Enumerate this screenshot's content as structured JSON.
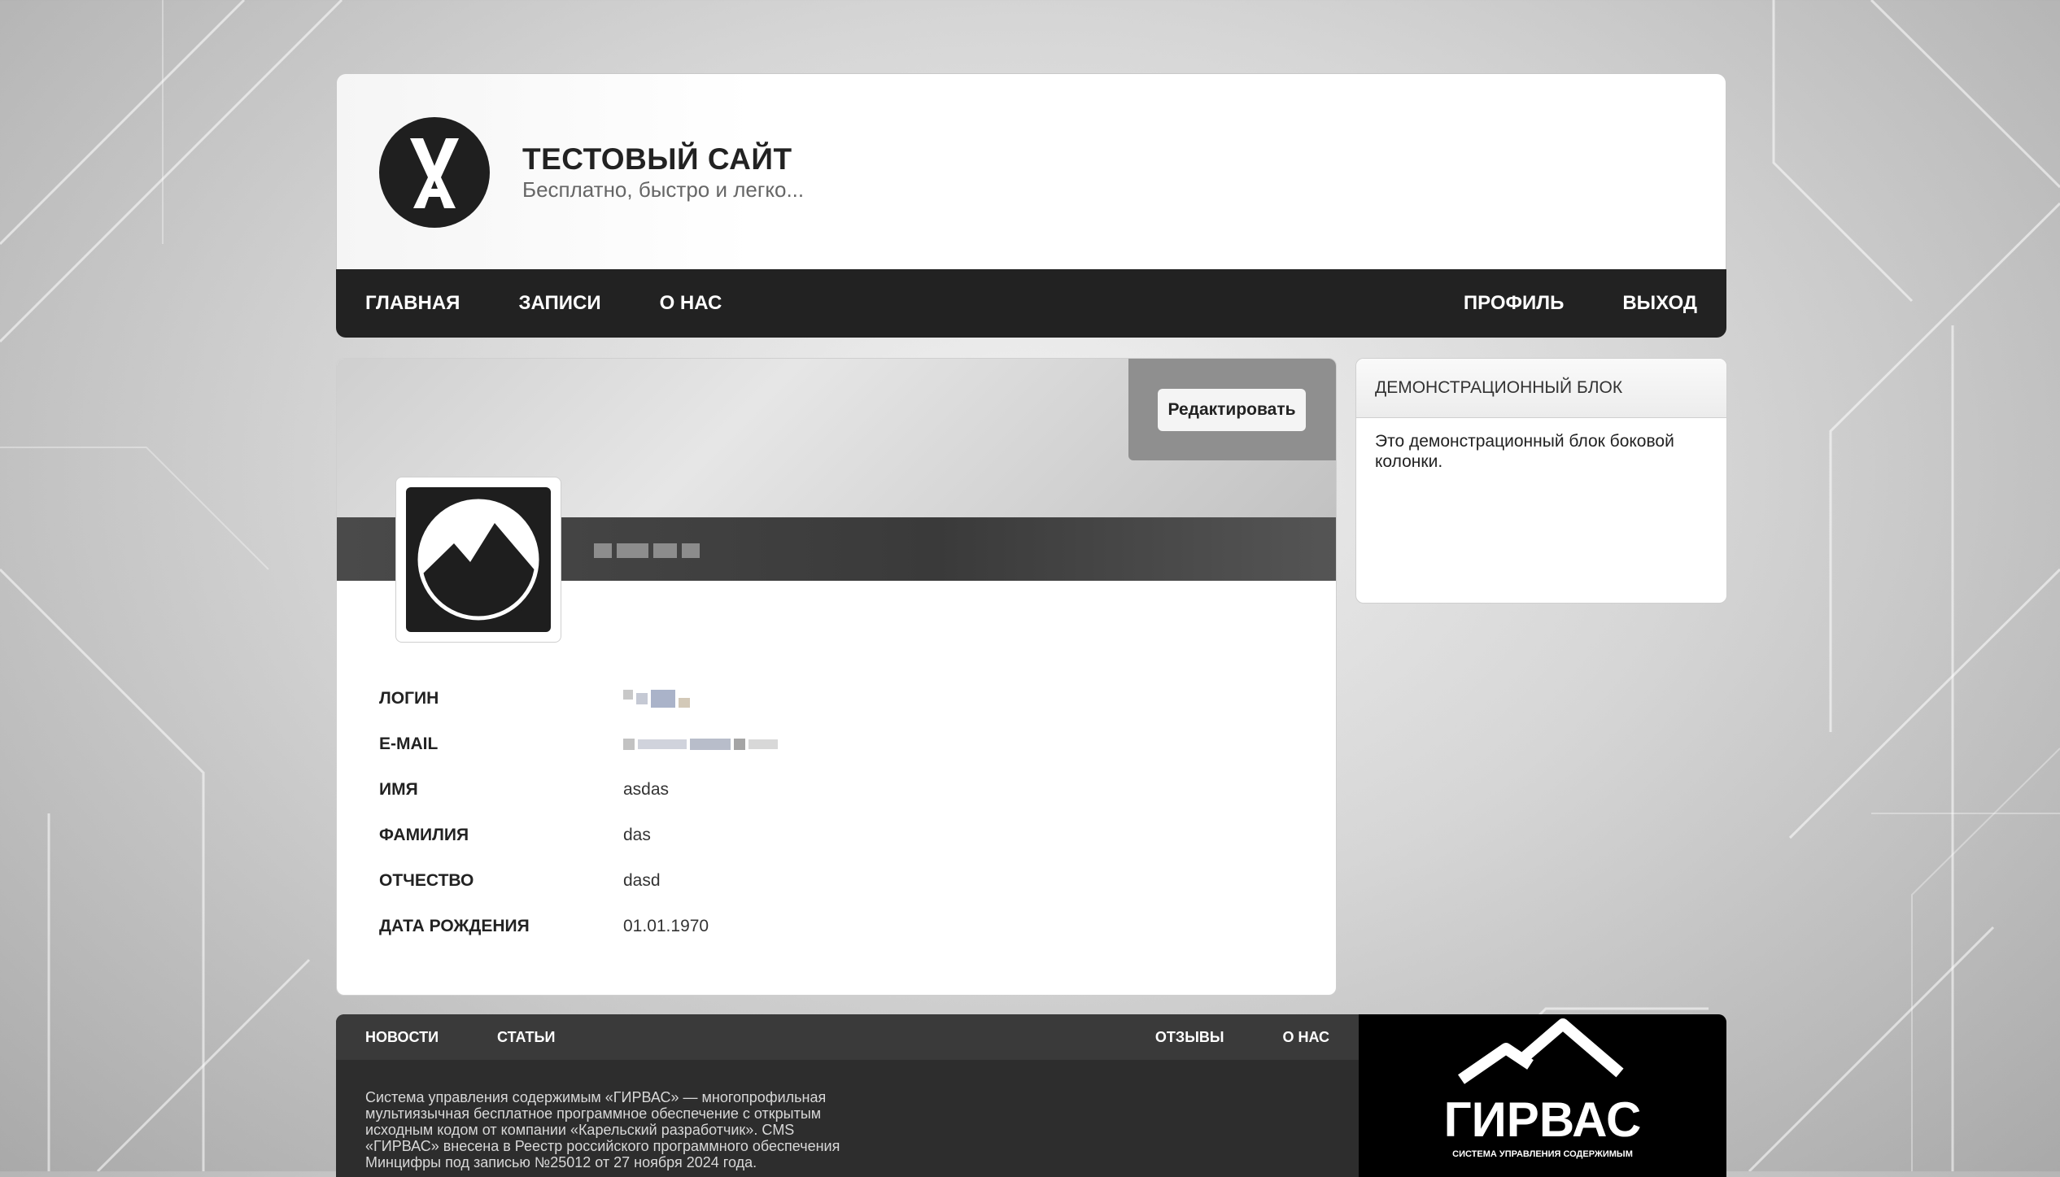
{
  "site": {
    "title": "ТЕСТОВЫЙ САЙТ",
    "subtitle": "Бесплатно, быстро и легко..."
  },
  "nav": {
    "left": [
      "Главная",
      "Записи",
      "О нас"
    ],
    "right": [
      "Профиль",
      "Выход"
    ]
  },
  "profile": {
    "edit_label": "Редактировать",
    "fields": [
      {
        "label": "Логин",
        "value": ""
      },
      {
        "label": "E-mail",
        "value": ""
      },
      {
        "label": "Имя",
        "value": "asdas"
      },
      {
        "label": "Фамилия",
        "value": "das"
      },
      {
        "label": "Отчество",
        "value": "dasd"
      },
      {
        "label": "Дата рождения",
        "value": "01.01.1970"
      }
    ]
  },
  "sidebar": {
    "title": "Демонстрационный блок",
    "text": "Это демонстрационный блок боковой колонки."
  },
  "footer": {
    "nav_left": [
      "Новости",
      "Статьи"
    ],
    "nav_right": [
      "Отзывы",
      "О нас"
    ],
    "text": "Система управления содержимым «ГИРВАС» — многопрофильная мультиязычная бесплатное программное обеспечение с открытым исходным кодом от компании «Карельский разработчик». CMS «ГИРВАС» внесена в Реестр российского программного обеспечения Минцифры под записью №25012 от 27 ноября 2024 года.",
    "logo_word": "ГИРВАС",
    "logo_tagline": "СИСТЕМА УПРАВЛЕНИЯ СОДЕРЖИМЫМ"
  },
  "colors": {
    "navbar": "#222222",
    "footer": "#2d2d2d",
    "footer_nav": "#3a3a3a"
  }
}
